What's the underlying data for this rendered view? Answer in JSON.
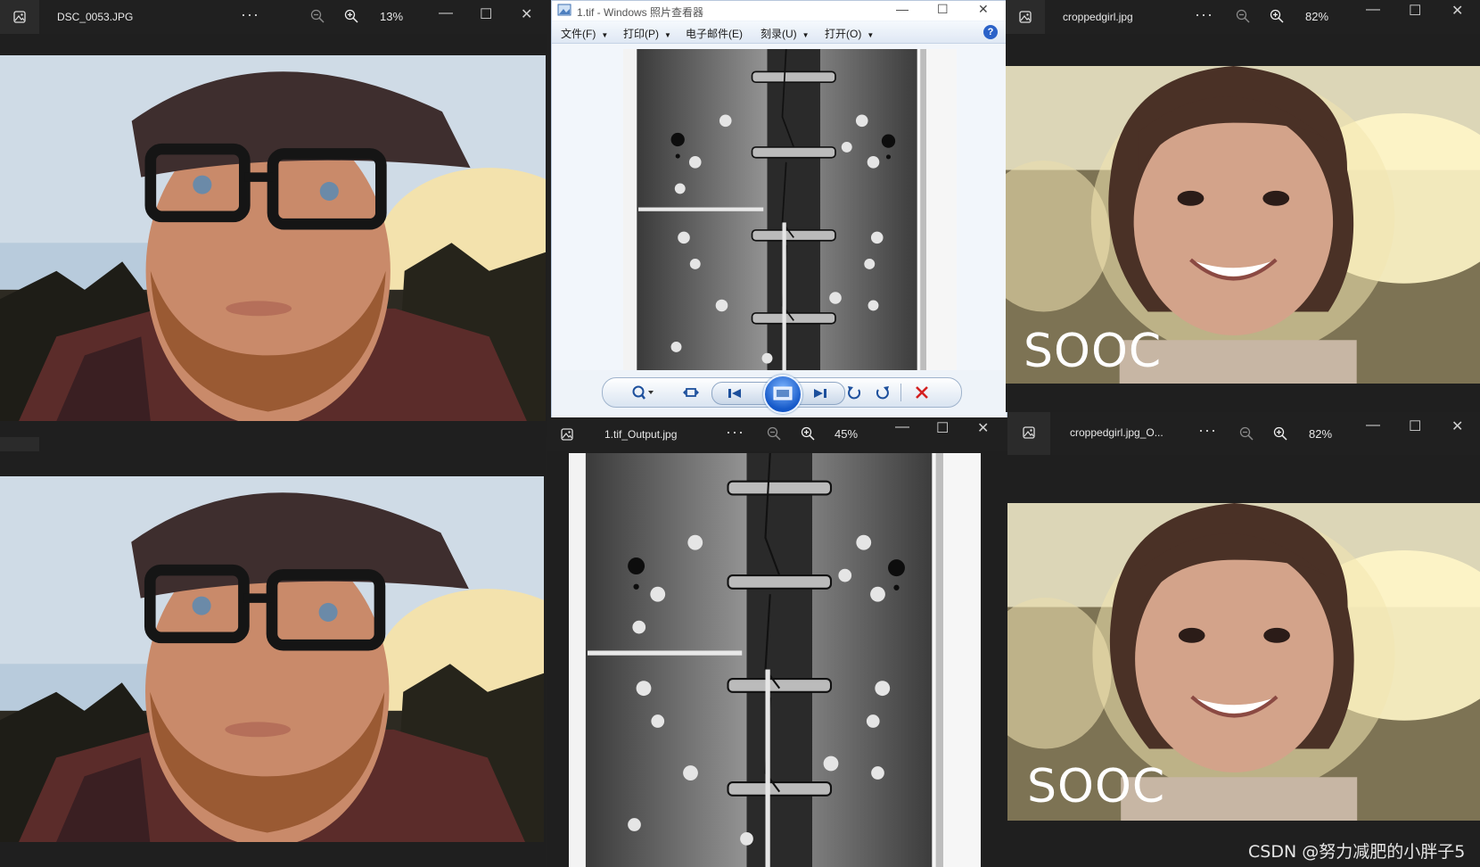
{
  "windows": {
    "top_left": {
      "filename": "DSC_0053.JPG",
      "zoom": "13%",
      "more": "···"
    },
    "bottom_middle": {
      "filename": "1.tif_Output.jpg",
      "zoom": "45%",
      "more": "···"
    },
    "top_right": {
      "filename": "croppedgirl.jpg",
      "zoom": "82%",
      "more": "···"
    },
    "bottom_right": {
      "filename": "croppedgirl.jpg_O...",
      "zoom": "82%",
      "more": "···"
    }
  },
  "classic_viewer": {
    "title": "1.tif - Windows 照片查看器",
    "menus": [
      "文件(F)",
      "打印(P)",
      "电子邮件(E)",
      "刻录(U)",
      "打开(O)"
    ],
    "help": "?"
  },
  "photo_overlays": {
    "sooc_top": "SOOC",
    "sooc_bottom": "SOOC"
  },
  "watermark": "CSDN @努力减肥的小胖子5",
  "colors": {
    "dark_chrome": "#202020",
    "classic_bg": "#eef3f9",
    "delete_red": "#d42020"
  },
  "icons": [
    "photos-app-icon",
    "zoom-out-icon",
    "zoom-in-icon",
    "minimize-icon",
    "maximize-icon",
    "close-icon",
    "zoom-icon",
    "fit-icon",
    "previous-icon",
    "slideshow-icon",
    "next-icon",
    "rotate-left-icon",
    "rotate-right-icon",
    "delete-icon",
    "help-icon"
  ]
}
